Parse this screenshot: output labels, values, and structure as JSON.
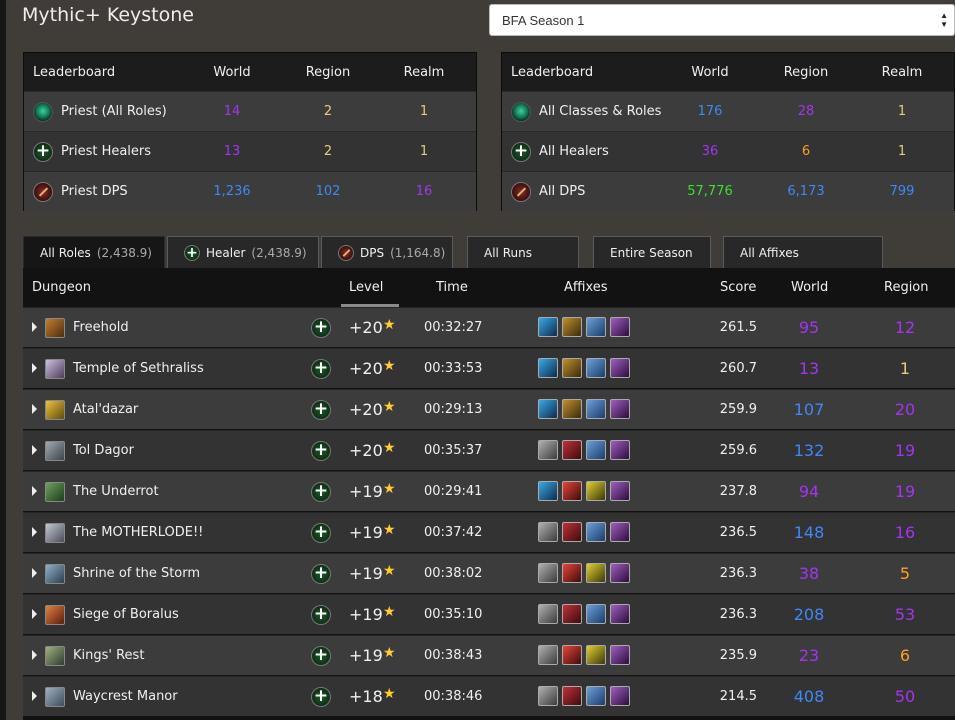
{
  "page": {
    "title": "Mythic+ Keystone"
  },
  "season_select": {
    "value": "BFA Season 1"
  },
  "leaderboard_left": {
    "headers": [
      "Leaderboard",
      "World",
      "Region",
      "Realm"
    ],
    "rows": [
      {
        "icon": "priest-spec-icon",
        "name": "Priest (All Roles)",
        "world": "14",
        "region": "2",
        "realm": "1"
      },
      {
        "icon": "healer-role-icon",
        "name": "Priest Healers",
        "world": "13",
        "region": "2",
        "realm": "1"
      },
      {
        "icon": "dps-role-icon",
        "name": "Priest DPS",
        "world": "1,236",
        "region": "102",
        "realm": "16"
      }
    ]
  },
  "leaderboard_right": {
    "headers": [
      "Leaderboard",
      "World",
      "Region",
      "Realm"
    ],
    "rows": [
      {
        "icon": "priest-spec-icon",
        "name": "All Classes & Roles",
        "world": "176",
        "region": "28",
        "realm": "1"
      },
      {
        "icon": "healer-role-icon",
        "name": "All Healers",
        "world": "36",
        "region": "6",
        "realm": "1"
      },
      {
        "icon": "dps-role-icon",
        "name": "All DPS",
        "world": "57,776",
        "region": "6,173",
        "realm": "799"
      }
    ]
  },
  "tabs": [
    {
      "label": "All Roles",
      "sub": "(2,438.9)"
    },
    {
      "label": "Healer",
      "sub": "(2,438.9)"
    },
    {
      "label": "DPS",
      "sub": "(1,164.8)"
    },
    {
      "label": "All Runs",
      "sub": ""
    },
    {
      "label": "Entire Season",
      "sub": ""
    },
    {
      "label": "All Affixes",
      "sub": ""
    }
  ],
  "runs_table": {
    "headers": {
      "dungeon": "Dungeon",
      "level": "Level",
      "time": "Time",
      "affixes": "Affixes",
      "score": "Score",
      "world": "World",
      "region": "Region"
    },
    "rows": [
      {
        "dungeon": "Freehold",
        "level": "+20",
        "time": "00:32:27",
        "score": "261.5",
        "world": "95",
        "region": "12"
      },
      {
        "dungeon": "Temple of Sethraliss",
        "level": "+20",
        "time": "00:33:53",
        "score": "260.7",
        "world": "13",
        "region": "1"
      },
      {
        "dungeon": "Atal'dazar",
        "level": "+20",
        "time": "00:29:13",
        "score": "259.9",
        "world": "107",
        "region": "20"
      },
      {
        "dungeon": "Tol Dagor",
        "level": "+20",
        "time": "00:35:37",
        "score": "259.6",
        "world": "132",
        "region": "19"
      },
      {
        "dungeon": "The Underrot",
        "level": "+19",
        "time": "00:29:41",
        "score": "237.8",
        "world": "94",
        "region": "19"
      },
      {
        "dungeon": "The MOTHERLODE!!",
        "level": "+19",
        "time": "00:37:42",
        "score": "236.5",
        "world": "148",
        "region": "16"
      },
      {
        "dungeon": "Shrine of the Storm",
        "level": "+19",
        "time": "00:38:02",
        "score": "236.3",
        "world": "38",
        "region": "5"
      },
      {
        "dungeon": "Siege of Boralus",
        "level": "+19",
        "time": "00:35:10",
        "score": "236.3",
        "world": "208",
        "region": "53"
      },
      {
        "dungeon": "Kings' Rest",
        "level": "+19",
        "time": "00:38:43",
        "score": "235.9",
        "world": "23",
        "region": "6"
      },
      {
        "dungeon": "Waycrest Manor",
        "level": "+18",
        "time": "00:38:46",
        "score": "214.5",
        "world": "408",
        "region": "50"
      }
    ]
  },
  "colors": {
    "rank_purple": "#a335ee",
    "rank_blue": "#3f88f5",
    "rank_orange": "#ff9f24",
    "rank_green": "#3ae02e",
    "rank_gold": "#f8c04a",
    "star": "#ffcc33"
  }
}
